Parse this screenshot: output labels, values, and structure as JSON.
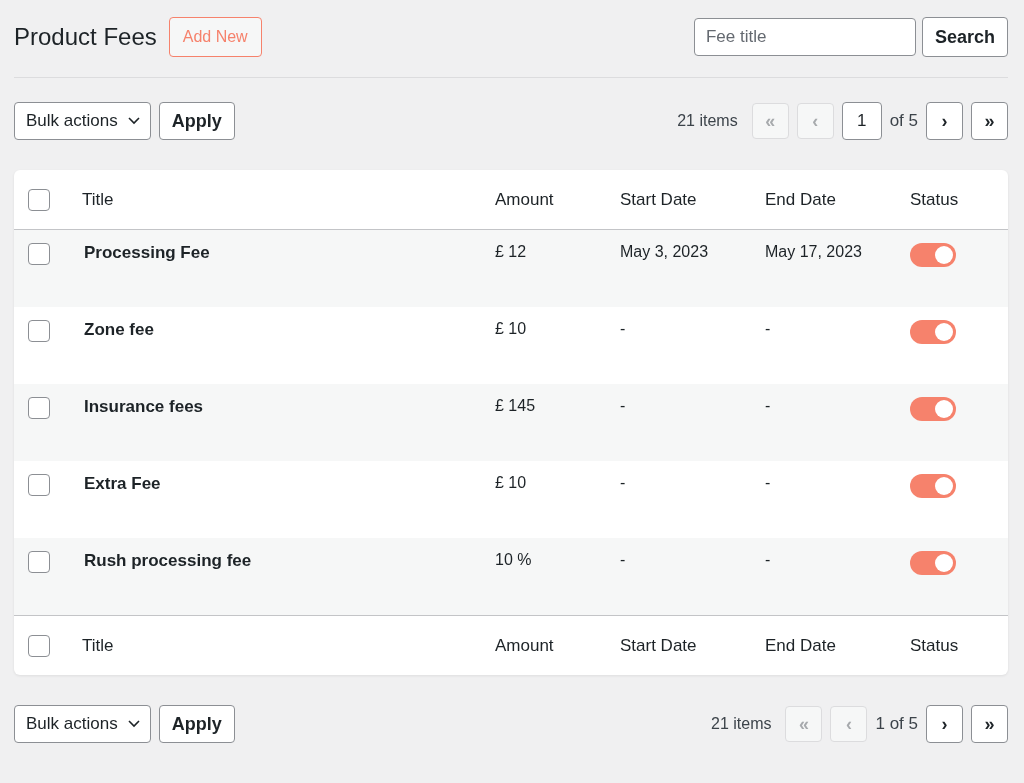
{
  "page": {
    "title": "Product Fees",
    "add_button": "Add New"
  },
  "search": {
    "placeholder": "Fee title",
    "button": "Search"
  },
  "top_nav": {
    "bulk_actions": "Bulk actions",
    "apply": "Apply",
    "count": "21 items",
    "buttons": [
      {
        "label": "«",
        "disabled": true
      },
      {
        "label": "‹",
        "disabled": true
      },
      {
        "label": "›",
        "disabled": false
      },
      {
        "label": "»",
        "disabled": false
      }
    ],
    "page_input": "1",
    "page_total": "of 5"
  },
  "table": {
    "columns": [
      "Title",
      "Amount",
      "Start Date",
      "End Date",
      "Status"
    ],
    "header_checked": false,
    "rows": [
      {
        "title": "Processing Fee",
        "amount": "£ 12",
        "start": "May 3, 2023",
        "end": "May 17, 2023",
        "checked": false,
        "on": true
      },
      {
        "title": "Zone fee",
        "amount": "£ 10",
        "start": "-",
        "end": "-",
        "checked": false,
        "on": true
      },
      {
        "title": "Insurance fees",
        "amount": "£ 145",
        "start": "-",
        "end": "-",
        "checked": false,
        "on": true
      },
      {
        "title": "Extra Fee",
        "amount": "£ 10",
        "start": "-",
        "end": "-",
        "checked": false,
        "on": true
      },
      {
        "title": "Rush processing fee",
        "amount": "10 %",
        "start": "-",
        "end": "-",
        "checked": false,
        "on": true
      }
    ],
    "footer_columns": [
      "Title",
      "Amount",
      "Start Date",
      "End Date",
      "Status"
    ],
    "footer_checked": false
  },
  "bottom_nav": {
    "bulk_actions": "Bulk actions",
    "apply": "Apply",
    "count": "21 items",
    "buttons": [
      {
        "label": "«",
        "disabled": true
      },
      {
        "label": "‹",
        "disabled": true
      },
      {
        "label": "›",
        "disabled": false
      },
      {
        "label": "»",
        "disabled": false
      }
    ],
    "page_text": "1 of 5"
  }
}
